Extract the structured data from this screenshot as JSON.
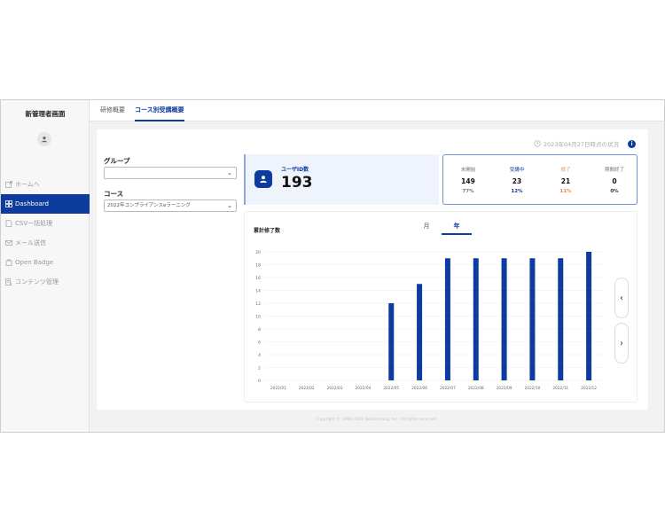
{
  "app": {
    "title": "新管理者画面"
  },
  "sidebar": {
    "items": [
      {
        "label": "ホームへ",
        "icon": "external-link-icon",
        "active": false
      },
      {
        "label": "Dashboard",
        "icon": "grid-icon",
        "active": true
      },
      {
        "label": "CSV一括処理",
        "icon": "file-icon",
        "active": false
      },
      {
        "label": "メール送信",
        "icon": "mail-icon",
        "active": false
      },
      {
        "label": "Open Badge",
        "icon": "badge-icon",
        "active": false
      },
      {
        "label": "コンテンツ管理",
        "icon": "content-icon",
        "active": false
      }
    ]
  },
  "header": {
    "tabs": [
      {
        "label": "研修概要",
        "active": false
      },
      {
        "label": "コース別受講概要",
        "active": true
      }
    ]
  },
  "status": {
    "as_of": "2023年04月27日時点の状況",
    "info_icon": "i"
  },
  "filters": {
    "group_label": "グループ",
    "group_value": "",
    "course_label": "コース",
    "course_value": "2022年コンプライアンスeラーニング"
  },
  "users": {
    "label": "ユーザID数",
    "value": "193"
  },
  "stats": [
    {
      "label": "未開始",
      "value": "149",
      "percent": "77%",
      "color": "#888888"
    },
    {
      "label": "受講中",
      "value": "23",
      "percent": "12%",
      "color": "#0d3b9e"
    },
    {
      "label": "修了",
      "value": "21",
      "percent": "11%",
      "color": "#f08a4b"
    },
    {
      "label": "期間終了",
      "value": "0",
      "percent": "0%",
      "color": "#555555"
    }
  ],
  "chart": {
    "title": "累計修了数",
    "tabs": [
      {
        "label": "月",
        "active": false
      },
      {
        "label": "年",
        "active": true
      }
    ],
    "prev": "‹",
    "next": "›"
  },
  "chart_data": {
    "type": "bar",
    "title": "累計修了数",
    "categories": [
      "2022/01",
      "2022/02",
      "2022/03",
      "2022/04",
      "2022/05",
      "2022/06",
      "2022/07",
      "2022/08",
      "2022/09",
      "2022/10",
      "2022/11",
      "2022/12"
    ],
    "values": [
      0,
      0,
      0,
      0,
      12,
      15,
      19,
      19,
      19,
      19,
      19,
      20
    ],
    "yticks": [
      "0",
      "2",
      "4",
      "6",
      "8",
      "10",
      "12",
      "14",
      "16",
      "18",
      "20"
    ],
    "ylim": [
      0,
      20
    ],
    "grid": true,
    "bar_color": "#0d3b9e"
  },
  "footer": {
    "copyright": "Copyright © 1999-2023 NetLearning, Inc. All rights reserved."
  }
}
